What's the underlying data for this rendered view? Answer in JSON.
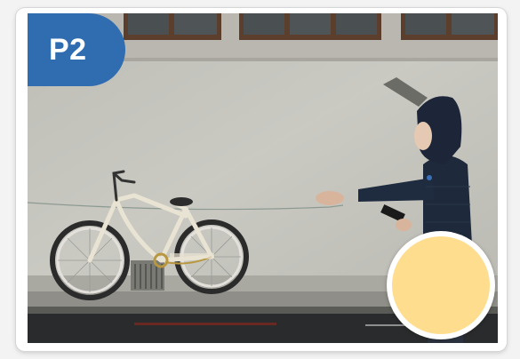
{
  "badge": {
    "label": "P2",
    "color": "#2f6db0"
  },
  "answer_circle": {
    "color": "#fedd8e"
  },
  "photo": {
    "scene": "photo-scene"
  }
}
